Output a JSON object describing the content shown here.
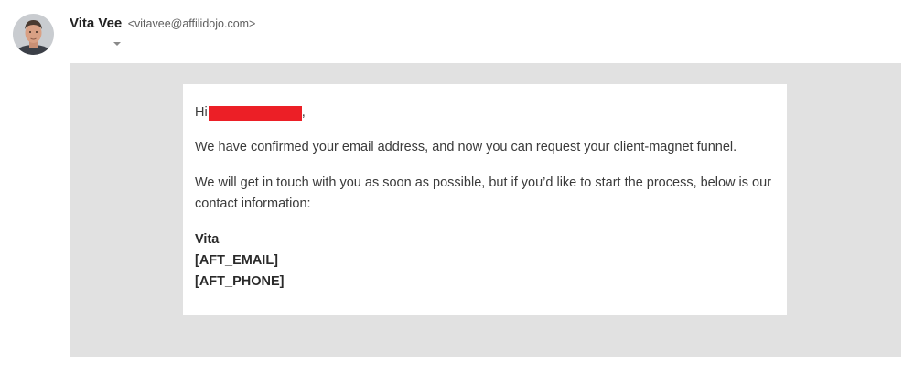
{
  "sender": {
    "name": "Vita Vee",
    "email": "<vitavee@affilidojo.com>"
  },
  "message": {
    "greeting_prefix": "Hi",
    "greeting_suffix": ",",
    "paragraph1": "We have confirmed your email address, and now you can request your client-magnet funnel.",
    "paragraph2": "We will get in touch with you as soon as possible, but if you’d like to start the process, below is our contact information:",
    "signature": {
      "name": "Vita",
      "email_placeholder": "[AFT_EMAIL]",
      "phone_placeholder": "[AFT_PHONE]"
    }
  },
  "colors": {
    "redaction": "#ec1f26",
    "body_background": "#e1e1e1",
    "card_background": "#ffffff"
  }
}
